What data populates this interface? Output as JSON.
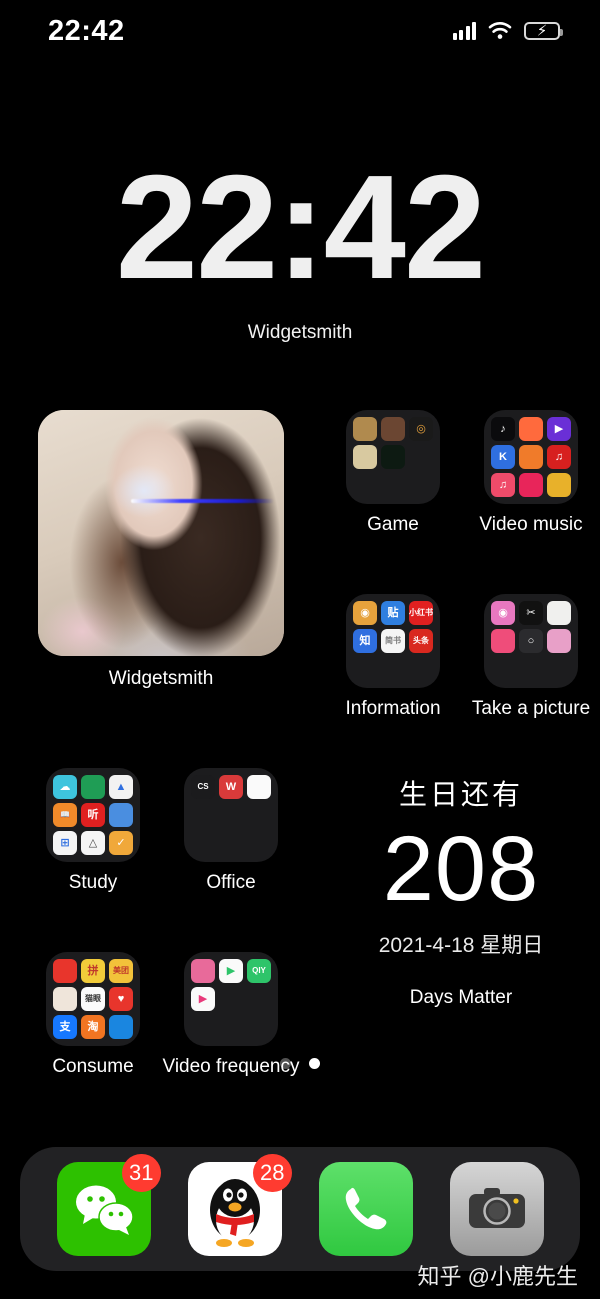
{
  "status_bar": {
    "time": "22:42",
    "signal_icon": "cellular-bars-icon",
    "wifi_icon": "wifi-icon",
    "battery_icon": "battery-charging-icon",
    "battery_charging": true
  },
  "clock_widget": {
    "time": "22:42",
    "app_label": "Widgetsmith"
  },
  "photo_widget": {
    "app_label": "Widgetsmith"
  },
  "days_widget": {
    "title": "生日还有",
    "count": "208",
    "date": "2021-4-18 星期日",
    "app_label": "Days Matter"
  },
  "folders": [
    {
      "name": "Game",
      "icons": [
        {
          "name": "game-icon-1",
          "glyph": "",
          "bg": "#b08a4e"
        },
        {
          "name": "game-icon-2",
          "glyph": "",
          "bg": "#6b4632"
        },
        {
          "name": "game-icon-3",
          "glyph": "◎",
          "bg": "#1a1a1a",
          "fg": "#e8a33d"
        },
        {
          "name": "game-icon-4",
          "glyph": "",
          "bg": "#d8c9a0"
        },
        {
          "name": "game-icon-5",
          "glyph": "",
          "bg": "#0d1a12"
        },
        {
          "name": "empty",
          "glyph": "",
          "bg": ""
        },
        {
          "name": "empty",
          "glyph": "",
          "bg": ""
        },
        {
          "name": "empty",
          "glyph": "",
          "bg": ""
        },
        {
          "name": "empty",
          "glyph": "",
          "bg": ""
        }
      ]
    },
    {
      "name": "Video music",
      "icons": [
        {
          "name": "tiktok-icon",
          "glyph": "♪",
          "bg": "#0b0b0d",
          "fg": "#ffffff"
        },
        {
          "name": "kuaishou-icon",
          "glyph": "",
          "bg": "#ff6a3d"
        },
        {
          "name": "video-editor-icon",
          "glyph": "▶",
          "bg": "#6a2fd6",
          "fg": "#ffffff"
        },
        {
          "name": "kugou-icon",
          "glyph": "K",
          "bg": "#2f6fe0",
          "fg": "#ffffff"
        },
        {
          "name": "bird-app-icon",
          "glyph": "",
          "bg": "#f07b2a"
        },
        {
          "name": "netease-music-icon",
          "glyph": "♫",
          "bg": "#d7201f",
          "fg": "#ffffff"
        },
        {
          "name": "apple-music-icon",
          "glyph": "♫",
          "bg": "#ef4b6a",
          "fg": "#ffffff"
        },
        {
          "name": "qq-music-icon",
          "glyph": "",
          "bg": "#e8255a"
        },
        {
          "name": "variety-app-icon",
          "glyph": "",
          "bg": "#e8b12a"
        }
      ]
    },
    {
      "name": "Information",
      "icons": [
        {
          "name": "weibo-icon",
          "glyph": "◉",
          "bg": "#e6a23c",
          "fg": "#ffffff"
        },
        {
          "name": "tieba-icon",
          "glyph": "贴",
          "bg": "#2f7fe0",
          "fg": "#ffffff"
        },
        {
          "name": "xiaohongshu-icon",
          "glyph": "小红书",
          "bg": "#e02020",
          "fg": "#ffffff"
        },
        {
          "name": "zhihu-icon",
          "glyph": "知",
          "bg": "#2f6fe0",
          "fg": "#ffffff"
        },
        {
          "name": "jianshu-icon",
          "glyph": "简书",
          "bg": "#f5f5f5",
          "fg": "#777777"
        },
        {
          "name": "toutiao-icon",
          "glyph": "头条",
          "bg": "#d9281f",
          "fg": "#ffffff"
        },
        {
          "name": "empty",
          "glyph": "",
          "bg": ""
        },
        {
          "name": "empty",
          "glyph": "",
          "bg": ""
        },
        {
          "name": "empty",
          "glyph": "",
          "bg": ""
        }
      ]
    },
    {
      "name": "Take a picture",
      "icons": [
        {
          "name": "camera-app-icon",
          "glyph": "◉",
          "bg": "#e878c0",
          "fg": "#ffffff"
        },
        {
          "name": "capcut-icon",
          "glyph": "✂",
          "bg": "#111111",
          "fg": "#ffffff"
        },
        {
          "name": "photo-editor-icon",
          "glyph": "",
          "bg": "#f0f0ee"
        },
        {
          "name": "beauty-cam-icon",
          "glyph": "",
          "bg": "#ef4d7a"
        },
        {
          "name": "circle-app-icon",
          "glyph": "○",
          "bg": "#2b2b2e",
          "fg": "#ffffff"
        },
        {
          "name": "colorful-app-icon",
          "glyph": "",
          "bg": "#e8a0c8"
        },
        {
          "name": "empty",
          "glyph": "",
          "bg": ""
        },
        {
          "name": "empty",
          "glyph": "",
          "bg": ""
        },
        {
          "name": "empty",
          "glyph": "",
          "bg": ""
        }
      ]
    },
    {
      "name": "Study",
      "icons": [
        {
          "name": "cloud-study-icon",
          "glyph": "☁",
          "bg": "#3ec4dd",
          "fg": "#ffffff"
        },
        {
          "name": "dictionary-icon",
          "glyph": "",
          "bg": "#1f9d55"
        },
        {
          "name": "graduation-icon",
          "glyph": "▲",
          "bg": "#f2f2f2",
          "fg": "#2f6fe0"
        },
        {
          "name": "book-icon",
          "glyph": "📖",
          "bg": "#f08a2a",
          "fg": "#ffffff"
        },
        {
          "name": "ting-icon",
          "glyph": "听",
          "bg": "#e02020",
          "fg": "#ffffff"
        },
        {
          "name": "notes-icon",
          "glyph": "",
          "bg": "#4a8ee0"
        },
        {
          "name": "grid-app-icon",
          "glyph": "⊞",
          "bg": "#f5f5f5",
          "fg": "#2f6fe0"
        },
        {
          "name": "triangle-app-icon",
          "glyph": "△",
          "bg": "#f5f5f5",
          "fg": "#444444"
        },
        {
          "name": "checklist-icon",
          "glyph": "✓",
          "bg": "#f0a83a",
          "fg": "#ffffff"
        }
      ]
    },
    {
      "name": "Office",
      "icons": [
        {
          "name": "camscanner-icon",
          "glyph": "CS",
          "bg": "#1b1b1d",
          "fg": "#ffffff"
        },
        {
          "name": "wps-office-icon",
          "glyph": "W",
          "bg": "#d93a3a",
          "fg": "#ffffff"
        },
        {
          "name": "baidu-netdisk-icon",
          "glyph": "",
          "bg": "#fafafa"
        },
        {
          "name": "empty",
          "glyph": "",
          "bg": ""
        },
        {
          "name": "empty",
          "glyph": "",
          "bg": ""
        },
        {
          "name": "empty",
          "glyph": "",
          "bg": ""
        },
        {
          "name": "empty",
          "glyph": "",
          "bg": ""
        },
        {
          "name": "empty",
          "glyph": "",
          "bg": ""
        },
        {
          "name": "empty",
          "glyph": "",
          "bg": ""
        }
      ]
    },
    {
      "name": "Consume",
      "icons": [
        {
          "name": "xianyu-icon",
          "glyph": "",
          "bg": "#e8352c"
        },
        {
          "name": "pinduoduo-icon",
          "glyph": "拼",
          "bg": "#f2cc3a",
          "fg": "#c0392b"
        },
        {
          "name": "meituan-icon",
          "glyph": "美团",
          "bg": "#f2c23a",
          "fg": "#c0392b"
        },
        {
          "name": "pet-app-icon",
          "glyph": "",
          "bg": "#efe5da"
        },
        {
          "name": "maoyan-icon",
          "glyph": "猫眼",
          "bg": "#fbfbfb",
          "fg": "#333333"
        },
        {
          "name": "health-app-icon",
          "glyph": "♥",
          "bg": "#e8352c",
          "fg": "#ffffff"
        },
        {
          "name": "alipay-icon",
          "glyph": "支",
          "bg": "#1678ff",
          "fg": "#ffffff"
        },
        {
          "name": "taobao-icon",
          "glyph": "淘",
          "bg": "#f27522",
          "fg": "#ffffff"
        },
        {
          "name": "dolphin-app-icon",
          "glyph": "",
          "bg": "#1a86e0"
        }
      ]
    },
    {
      "name": "Video frequency",
      "icons": [
        {
          "name": "bilibili-icon",
          "glyph": "",
          "bg": "#e86a9a"
        },
        {
          "name": "youku-icon",
          "glyph": "▶",
          "bg": "#fafafa",
          "fg": "#2ec46a"
        },
        {
          "name": "iqiyi-icon",
          "glyph": "QIY",
          "bg": "#2ec46a",
          "fg": "#ffffff"
        },
        {
          "name": "tencent-video-icon",
          "glyph": "▶",
          "bg": "#fafafa",
          "fg": "#e8397a"
        },
        {
          "name": "empty",
          "glyph": "",
          "bg": ""
        },
        {
          "name": "empty",
          "glyph": "",
          "bg": ""
        },
        {
          "name": "empty",
          "glyph": "",
          "bg": ""
        },
        {
          "name": "empty",
          "glyph": "",
          "bg": ""
        },
        {
          "name": "empty",
          "glyph": "",
          "bg": ""
        }
      ]
    }
  ],
  "page_dots": {
    "count": 2,
    "active_index": 1
  },
  "dock": {
    "items": [
      {
        "name": "WeChat",
        "icon": "wechat-icon",
        "badge": "31"
      },
      {
        "name": "QQ",
        "icon": "qq-icon",
        "badge": "28"
      },
      {
        "name": "Phone",
        "icon": "phone-icon",
        "badge": ""
      },
      {
        "name": "Camera",
        "icon": "camera-icon",
        "badge": ""
      }
    ]
  },
  "watermark": {
    "text": "知乎 @小鹿先生"
  },
  "colors": {
    "background": "#000000",
    "badge_red": "#ff3b30",
    "wechat_green": "#2dc100",
    "phone_green": "#30c840",
    "battery_green": "#32d74b",
    "folder_bg": "#1c1c1e",
    "dock_bg": "rgba(42,42,44,0.82)"
  }
}
